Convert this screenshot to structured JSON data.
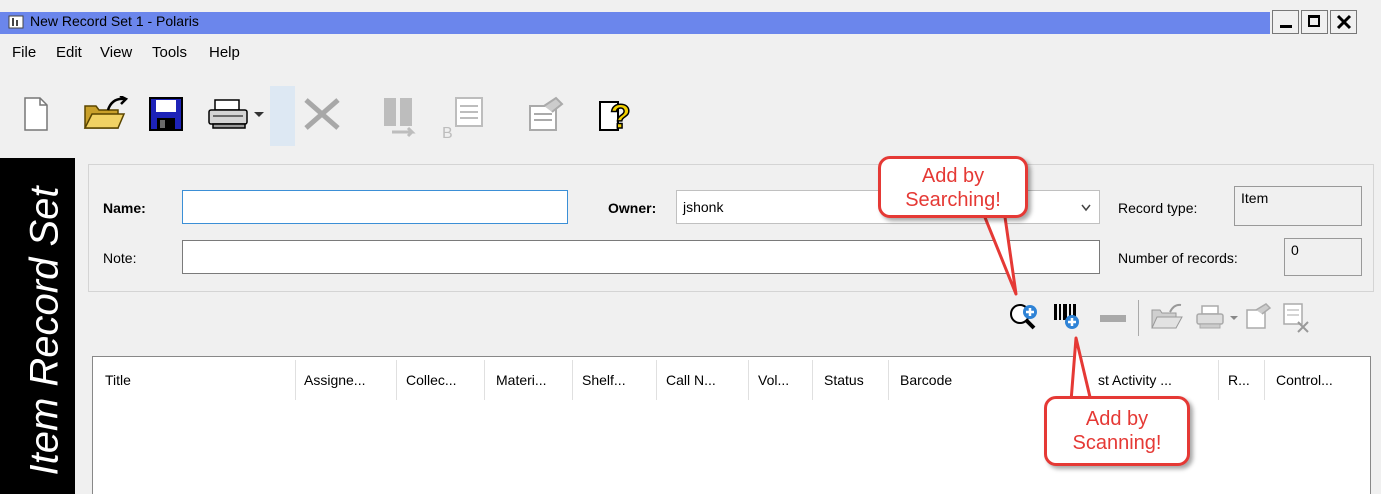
{
  "window": {
    "title": "New Record Set 1 -  Polaris",
    "minimize": "_",
    "maximize": "□",
    "close": "X"
  },
  "menu": [
    "File",
    "Edit",
    "View",
    "Tools",
    "Help"
  ],
  "toolbar": {
    "icons": [
      "new-document-icon",
      "open-folder-icon",
      "save-icon",
      "print-icon",
      "print-dropdown-icon",
      "delete-icon",
      "bulk-change-icon",
      "barcode-icon",
      "properties-icon",
      "help-icon"
    ]
  },
  "banner": {
    "text": "Item Record Set"
  },
  "form": {
    "name_label": "Name:",
    "name_value": "",
    "owner_label": "Owner:",
    "owner_value": "jshonk",
    "note_label": "Note:",
    "note_value": "",
    "record_type_label": "Record type:",
    "record_type_value": "Item",
    "num_records_label": "Number of records:",
    "num_records_value": "0"
  },
  "list_toolbar": {
    "icons": [
      "find-add-icon",
      "scan-add-icon",
      "remove-icon",
      "open-icon",
      "print-icon",
      "print-dropdown-icon",
      "properties-icon",
      "clear-icon"
    ]
  },
  "list": {
    "columns": [
      "Title",
      "Assigne...",
      "Collec...",
      "Materi...",
      "Shelf...",
      "Call N...",
      "Vol...",
      "Status",
      "Barcode",
      "st Activity ...",
      "R...",
      "Control..."
    ]
  },
  "callouts": {
    "search": [
      "Add by",
      "Searching!"
    ],
    "scan": [
      "Add by",
      "Scanning!"
    ]
  },
  "colors": {
    "titlebar": "#6b86ec",
    "callout_border": "#e53935",
    "banner_bg": "#000000"
  }
}
